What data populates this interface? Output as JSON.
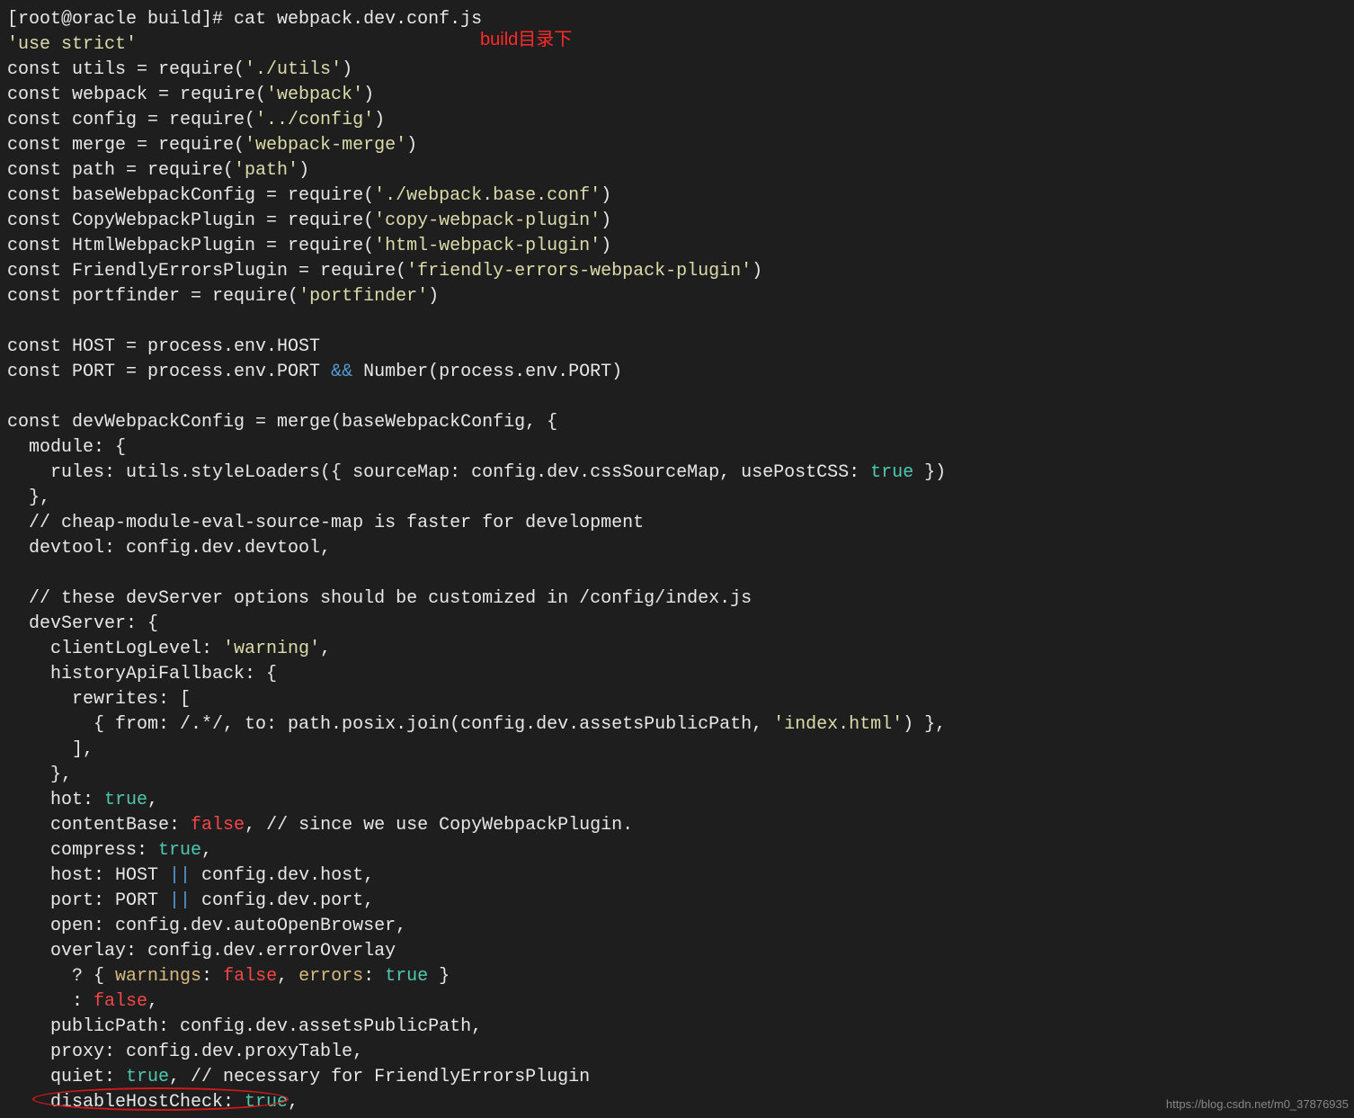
{
  "overlay": "build目录下",
  "watermark": "https://blog.csdn.net/m0_37876935",
  "lines": [
    {
      "t": "prompt",
      "text": "[root@oracle build]# cat webpack.dev.conf.js"
    },
    {
      "t": "mix",
      "parts": [
        [
          "yellow",
          "'use strict'"
        ]
      ]
    },
    {
      "t": "mix",
      "parts": [
        [
          "white",
          "const utils = require("
        ],
        [
          "yellow",
          "'./utils'"
        ],
        [
          "white",
          ")"
        ]
      ]
    },
    {
      "t": "mix",
      "parts": [
        [
          "white",
          "const webpack = require("
        ],
        [
          "yellow",
          "'webpack'"
        ],
        [
          "white",
          ")"
        ]
      ]
    },
    {
      "t": "mix",
      "parts": [
        [
          "white",
          "const config = require("
        ],
        [
          "yellow",
          "'../config'"
        ],
        [
          "white",
          ")"
        ]
      ]
    },
    {
      "t": "mix",
      "parts": [
        [
          "white",
          "const merge = require("
        ],
        [
          "yellow",
          "'webpack-merge'"
        ],
        [
          "white",
          ")"
        ]
      ]
    },
    {
      "t": "mix",
      "parts": [
        [
          "white",
          "const path = require("
        ],
        [
          "yellow",
          "'path'"
        ],
        [
          "white",
          ")"
        ]
      ]
    },
    {
      "t": "mix",
      "parts": [
        [
          "white",
          "const baseWebpackConfig = require("
        ],
        [
          "yellow",
          "'./webpack.base.conf'"
        ],
        [
          "white",
          ")"
        ]
      ]
    },
    {
      "t": "mix",
      "parts": [
        [
          "white",
          "const CopyWebpackPlugin = require("
        ],
        [
          "yellow",
          "'copy-webpack-plugin'"
        ],
        [
          "white",
          ")"
        ]
      ]
    },
    {
      "t": "mix",
      "parts": [
        [
          "white",
          "const HtmlWebpackPlugin = require("
        ],
        [
          "yellow",
          "'html-webpack-plugin'"
        ],
        [
          "white",
          ")"
        ]
      ]
    },
    {
      "t": "mix",
      "parts": [
        [
          "white",
          "const FriendlyErrorsPlugin = require("
        ],
        [
          "yellow",
          "'friendly-errors-webpack-plugin'"
        ],
        [
          "white",
          ")"
        ]
      ]
    },
    {
      "t": "mix",
      "parts": [
        [
          "white",
          "const portfinder = require("
        ],
        [
          "yellow",
          "'portfinder'"
        ],
        [
          "white",
          ")"
        ]
      ]
    },
    {
      "t": "blank",
      "text": ""
    },
    {
      "t": "plain",
      "text": "const HOST = process.env.HOST"
    },
    {
      "t": "mix",
      "parts": [
        [
          "white",
          "const PORT = process.env.PORT "
        ],
        [
          "operator",
          "&&"
        ],
        [
          "white",
          " Number(process.env.PORT)"
        ]
      ]
    },
    {
      "t": "blank",
      "text": ""
    },
    {
      "t": "plain",
      "text": "const devWebpackConfig = merge(baseWebpackConfig, {"
    },
    {
      "t": "plain",
      "text": "  module: {"
    },
    {
      "t": "mix",
      "parts": [
        [
          "white",
          "    rules: utils.styleLoaders({ sourceMap: config.dev.cssSourceMap, usePostCSS: "
        ],
        [
          "green",
          "true"
        ],
        [
          "white",
          " })"
        ]
      ]
    },
    {
      "t": "plain",
      "text": "  },"
    },
    {
      "t": "plain",
      "text": "  // cheap-module-eval-source-map is faster for development"
    },
    {
      "t": "plain",
      "text": "  devtool: config.dev.devtool,"
    },
    {
      "t": "blank",
      "text": ""
    },
    {
      "t": "plain",
      "text": "  // these devServer options should be customized in /config/index.js"
    },
    {
      "t": "plain",
      "text": "  devServer: {"
    },
    {
      "t": "mix",
      "parts": [
        [
          "white",
          "    clientLogLevel: "
        ],
        [
          "yellow",
          "'warning'"
        ],
        [
          "white",
          ","
        ]
      ]
    },
    {
      "t": "plain",
      "text": "    historyApiFallback: {"
    },
    {
      "t": "plain",
      "text": "      rewrites: ["
    },
    {
      "t": "mix",
      "parts": [
        [
          "white",
          "        { from: /.*/, to: path.posix.join(config.dev.assetsPublicPath, "
        ],
        [
          "yellow",
          "'index.html'"
        ],
        [
          "white",
          ") },"
        ]
      ]
    },
    {
      "t": "plain",
      "text": "      ],"
    },
    {
      "t": "plain",
      "text": "    },"
    },
    {
      "t": "mix",
      "parts": [
        [
          "white",
          "    hot: "
        ],
        [
          "green",
          "true"
        ],
        [
          "white",
          ","
        ]
      ]
    },
    {
      "t": "mix",
      "parts": [
        [
          "white",
          "    contentBase: "
        ],
        [
          "red",
          "false"
        ],
        [
          "white",
          ", // since we use CopyWebpackPlugin."
        ]
      ]
    },
    {
      "t": "mix",
      "parts": [
        [
          "white",
          "    compress: "
        ],
        [
          "green",
          "true"
        ],
        [
          "white",
          ","
        ]
      ]
    },
    {
      "t": "mix",
      "parts": [
        [
          "white",
          "    host: HOST "
        ],
        [
          "operator",
          "||"
        ],
        [
          "white",
          " config.dev.host,"
        ]
      ]
    },
    {
      "t": "mix",
      "parts": [
        [
          "white",
          "    port: PORT "
        ],
        [
          "operator",
          "||"
        ],
        [
          "white",
          " config.dev.port,"
        ]
      ]
    },
    {
      "t": "plain",
      "text": "    open: config.dev.autoOpenBrowser,"
    },
    {
      "t": "plain",
      "text": "    overlay: config.dev.errorOverlay"
    },
    {
      "t": "mix",
      "parts": [
        [
          "white",
          "      ? { "
        ],
        [
          "orange",
          "warnings"
        ],
        [
          "white",
          ": "
        ],
        [
          "red",
          "false"
        ],
        [
          "white",
          ", "
        ],
        [
          "orange",
          "errors"
        ],
        [
          "white",
          ": "
        ],
        [
          "green",
          "true"
        ],
        [
          "white",
          " }"
        ]
      ]
    },
    {
      "t": "mix",
      "parts": [
        [
          "white",
          "      : "
        ],
        [
          "red",
          "false"
        ],
        [
          "white",
          ","
        ]
      ]
    },
    {
      "t": "plain",
      "text": "    publicPath: config.dev.assetsPublicPath,"
    },
    {
      "t": "plain",
      "text": "    proxy: config.dev.proxyTable,"
    },
    {
      "t": "mix",
      "parts": [
        [
          "white",
          "    quiet: "
        ],
        [
          "green",
          "true"
        ],
        [
          "white",
          ", // necessary for FriendlyErrorsPlugin"
        ]
      ]
    },
    {
      "t": "mix",
      "parts": [
        [
          "white",
          "    disableHostCheck: "
        ],
        [
          "green",
          "true"
        ],
        [
          "white",
          ","
        ]
      ]
    }
  ]
}
